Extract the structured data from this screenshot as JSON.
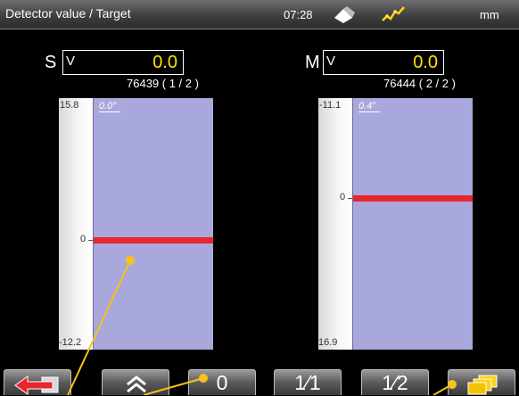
{
  "header": {
    "title": "Detector value / Target",
    "time": "07:28",
    "unit": "mm"
  },
  "channels": [
    {
      "letter": "S",
      "mode": "V",
      "value": "0.0",
      "serial": "76439 ( 1 / 2 )",
      "scale_top": "15.8",
      "scale_mid": "0",
      "scale_bottom": "-12.2",
      "angle": "0.0°",
      "range_top": 15.8,
      "range_bottom": -12.2,
      "marker_value": 0
    },
    {
      "letter": "M",
      "mode": "V",
      "value": "0.0",
      "serial": "76444 ( 2 / 2 )",
      "scale_top": "-11.1",
      "scale_mid": "0",
      "scale_bottom": "16.9",
      "angle": "0.4°",
      "range_top": -11.1,
      "range_bottom": 16.9,
      "marker_value": 0
    }
  ],
  "toolbar": {
    "buttons": [
      {
        "name": "back-button",
        "label": "",
        "icon": "back-arrow-icon"
      },
      {
        "name": "expand-button",
        "label": "",
        "icon": "double-chevron-up-icon"
      },
      {
        "name": "zero-button",
        "label": "0",
        "icon": ""
      },
      {
        "name": "full-scale-button",
        "label": "1⁄1",
        "icon": ""
      },
      {
        "name": "half-scale-button",
        "label": "1⁄2",
        "icon": ""
      },
      {
        "name": "windows-button",
        "label": "",
        "icon": "windows-icon"
      }
    ]
  },
  "colors": {
    "value": "#ffe400",
    "gauge_fill": "#a9a8dc",
    "marker": "#e8262c",
    "callout": "#f7c21a"
  }
}
